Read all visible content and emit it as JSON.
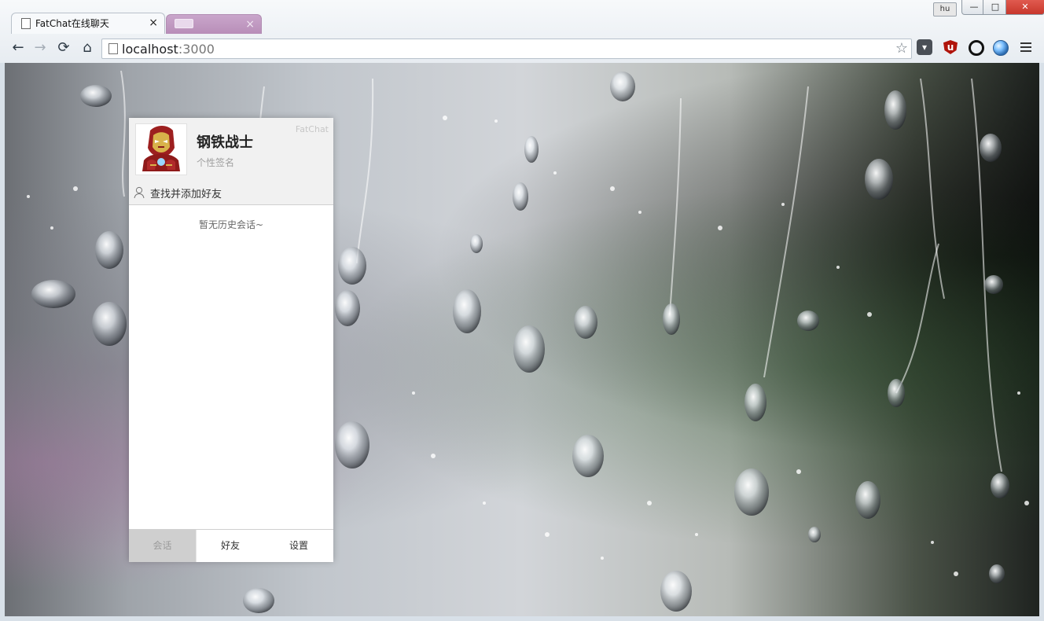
{
  "browser": {
    "active_tab_title": "FatChat在线聊天",
    "close_glyph": "×",
    "address_host": "localhost",
    "address_port": ":3000",
    "user_badge": "hu"
  },
  "toolbar": {
    "extensions": [
      "pocket",
      "ublock-origin",
      "ring",
      "globe"
    ]
  },
  "chat": {
    "brand": "FatChat",
    "username": "钢铁战士",
    "signature": "个性签名",
    "search_add_friend": "查找并添加好友",
    "empty_history": "暂无历史会话~",
    "tabs": [
      {
        "label": "会话",
        "active": true
      },
      {
        "label": "好友",
        "active": false
      },
      {
        "label": "设置",
        "active": false
      }
    ]
  },
  "colors": {
    "window_close": "#d6473b",
    "inactive_tab": "#c39fc5",
    "panel_header": "#f1f1f1",
    "active_bottom_tab": "#cfcfcf"
  },
  "icons": {
    "nav": [
      "back-arrow-icon",
      "forward-arrow-icon",
      "reload-icon",
      "home-icon"
    ],
    "bookmark": "star-icon",
    "menu": "hamburger-menu-icon"
  }
}
